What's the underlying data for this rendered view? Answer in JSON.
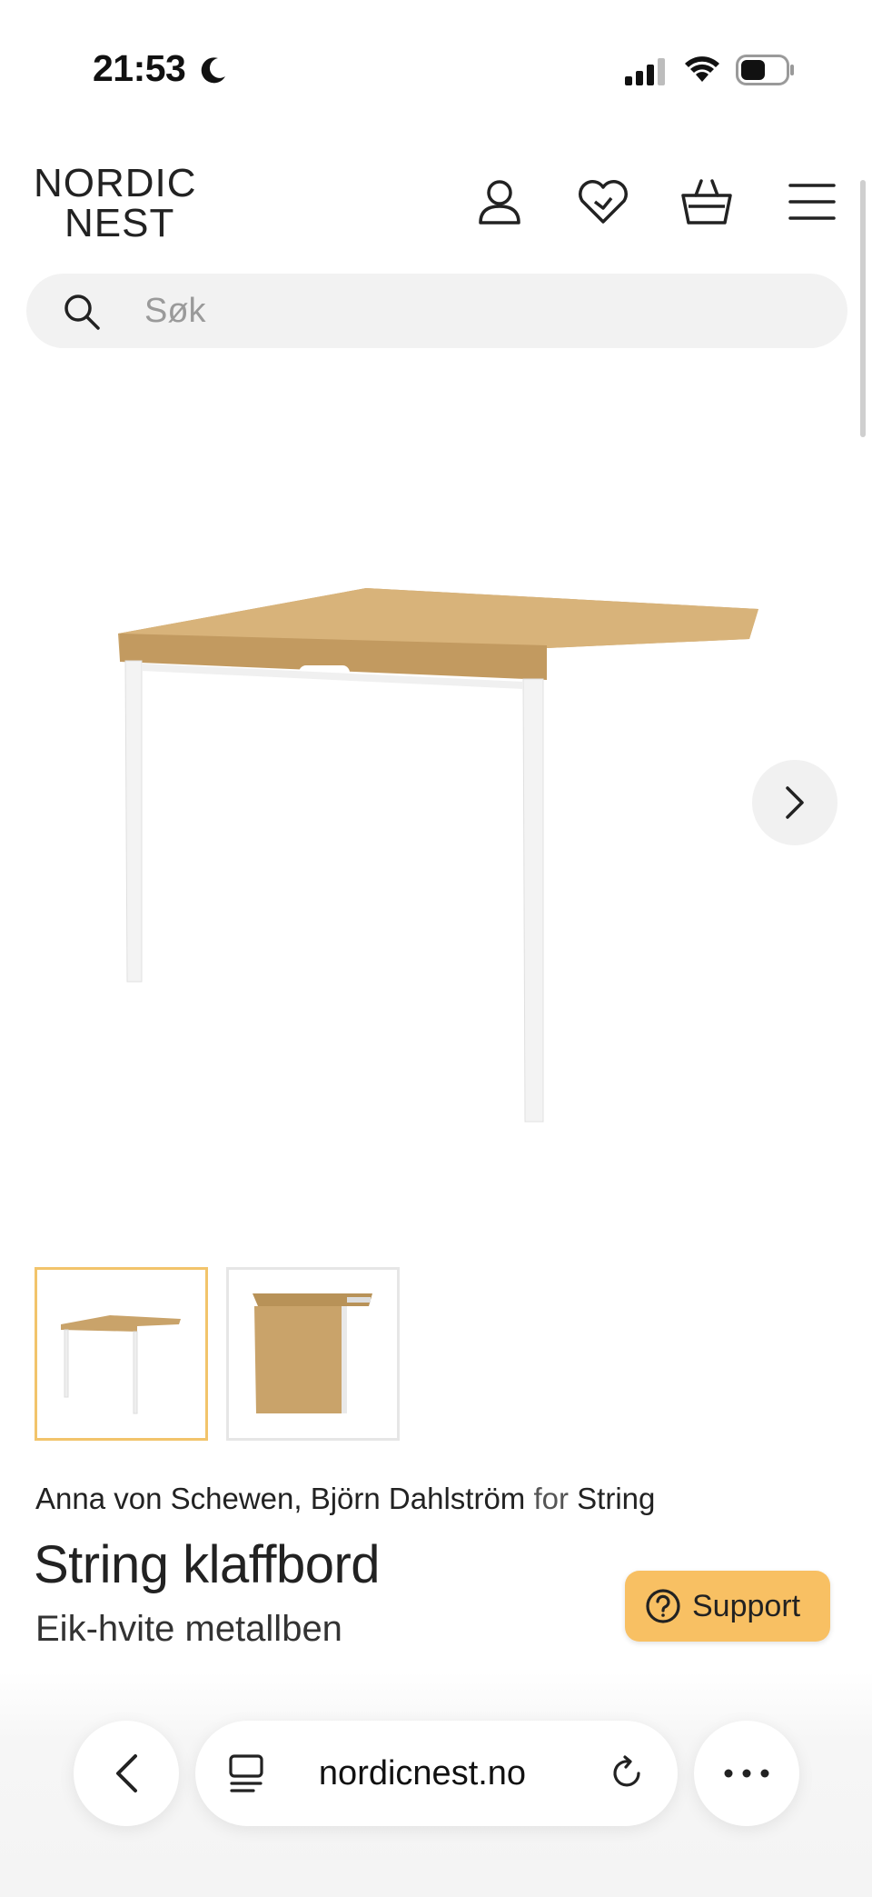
{
  "status_bar": {
    "time": "21:53",
    "icons": [
      "moon-icon",
      "cellular-signal-icon",
      "wifi-icon",
      "battery-icon"
    ]
  },
  "header": {
    "logo_line1": "NORDIC",
    "logo_line2": "NEST",
    "icons": [
      "account-icon",
      "wishlist-heart-icon",
      "cart-basket-icon",
      "menu-icon"
    ]
  },
  "search": {
    "placeholder": "Søk",
    "value": ""
  },
  "gallery": {
    "main_image": "table-image",
    "thumbnails_count": 2,
    "selected_thumbnail": 1
  },
  "product": {
    "designer_1": "Anna von Schewen",
    "separator": ",",
    "designer_2": "Björn Dahlström",
    "for_word": "for",
    "brand": "String",
    "title": "String klaffbord",
    "variant": "Eik-hvite metallben"
  },
  "support": {
    "label": "Support"
  },
  "browser": {
    "url": "nordicnest.no"
  },
  "colors": {
    "accent_thumbnail_border": "#f2c46b",
    "support_button": "#f8c063",
    "search_bg": "#f2f2f2",
    "text": "#222222"
  }
}
